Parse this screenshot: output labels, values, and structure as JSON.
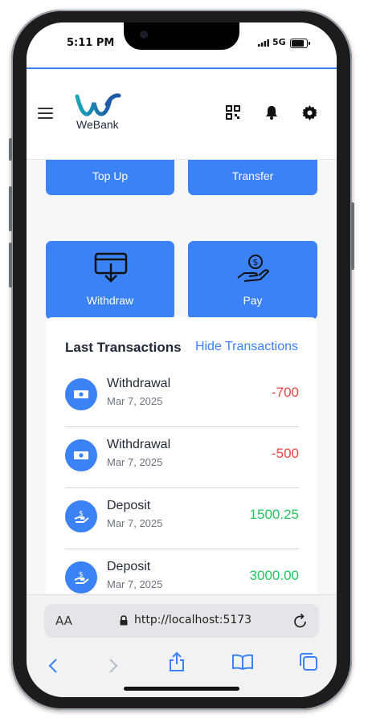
{
  "status_bar": {
    "time": "5:11 PM",
    "network": "5G"
  },
  "header": {
    "brand": "WeBank",
    "icons": [
      "menu-icon",
      "qr-code-icon",
      "bell-icon",
      "gear-icon"
    ]
  },
  "actions": {
    "top_up": "Top Up",
    "transfer": "Transfer",
    "withdraw": "Withdraw",
    "pay": "Pay"
  },
  "transactions": {
    "title": "Last Transactions",
    "toggle_label": "Hide Transactions",
    "items": [
      {
        "name": "Withdrawal",
        "date": "Mar 7, 2025",
        "amount": "-700",
        "type": "withdrawal"
      },
      {
        "name": "Withdrawal",
        "date": "Mar 7, 2025",
        "amount": "-500",
        "type": "withdrawal"
      },
      {
        "name": "Deposit",
        "date": "Mar 7, 2025",
        "amount": "1500.25",
        "type": "deposit"
      },
      {
        "name": "Deposit",
        "date": "Mar 7, 2025",
        "amount": "3000.00",
        "type": "deposit"
      }
    ]
  },
  "browser": {
    "text_size_label": "AA",
    "url": "http://localhost:5173"
  },
  "colors": {
    "accent": "#3b82f6",
    "negative": "#ef4444",
    "positive": "#22c55e"
  }
}
